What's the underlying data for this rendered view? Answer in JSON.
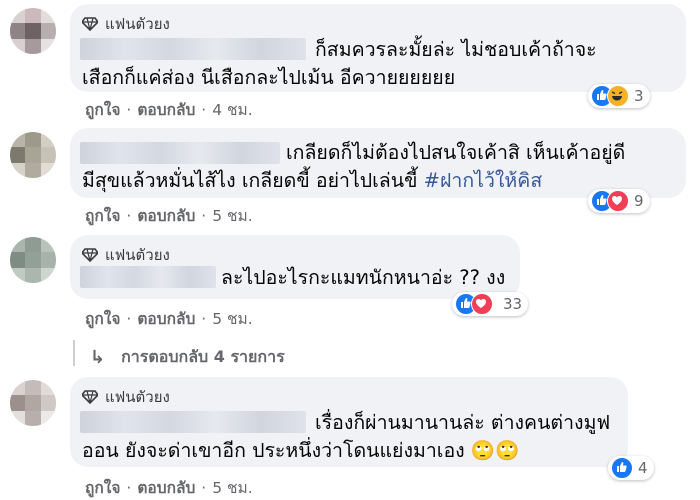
{
  "comments": [
    {
      "badge": "แฟนตัวยง",
      "lines": [
        "ก็สมควรละมั้ยล่ะ ไม่ชอบเค้าถ้าจะ",
        "เสือกก็แค่ส่อง นีเสือกละไปเม้น อีควายยยยยย"
      ],
      "like_label": "ถูกใจ",
      "reply_label": "ตอบกลับ",
      "time": "4 ชม.",
      "reaction_count": "3",
      "reaction_icons": [
        "like-icon",
        "haha-icon"
      ]
    },
    {
      "badge": "",
      "lines": [
        "เกลียดก็ไม่ต้องไปสนใจเค้าสิ เห็นเค้าอยู่ดี",
        "มีสุขแล้วหมั่นไส้ไง เกลียดขี้ อย่าไปเล่นขี้ "
      ],
      "hashtag": "#ฝากไว้ให้คิส",
      "like_label": "ถูกใจ",
      "reply_label": "ตอบกลับ",
      "time": "5 ชม.",
      "reaction_count": "9",
      "reaction_icons": [
        "like-icon",
        "love-icon"
      ]
    },
    {
      "badge": "แฟนตัวยง",
      "lines": [
        "ละไปอะไรกะแมทนักหนาอ่ะ ?? งง"
      ],
      "like_label": "ถูกใจ",
      "reply_label": "ตอบกลับ",
      "time": "5 ชม.",
      "reaction_count": "33",
      "reaction_icons": [
        "like-icon",
        "love-icon"
      ]
    },
    {
      "badge": "แฟนตัวยง",
      "lines": [
        "เรื่องก็ผ่านมานานล่ะ ต่างคนต่างมูฟ",
        "ออน ยังจะด่าเขาอีก ประหนึ่งว่าโดนแย่งมาเอง 🙄🙄"
      ],
      "like_label": "ถูกใจ",
      "reply_label": "ตอบกลับ",
      "time": "5 ชม.",
      "reaction_count": "4",
      "reaction_icons": [
        "like-icon"
      ]
    }
  ],
  "replies_link": "การตอบกลับ 4 รายการ",
  "colors": {
    "bubble": "#f0f2f5",
    "meta": "#65676b",
    "hashtag": "#385898",
    "like": "#1877f2",
    "love": "#f33e58",
    "haha": "#f7b125"
  }
}
